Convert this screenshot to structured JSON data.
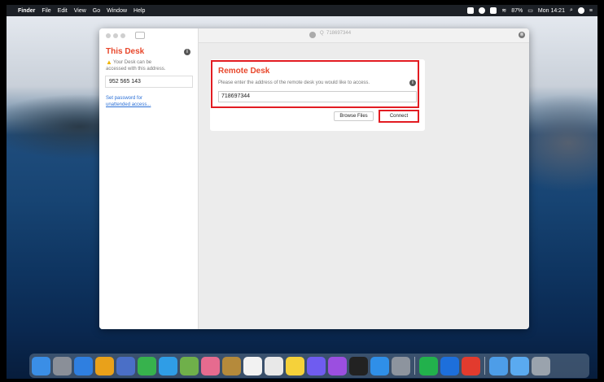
{
  "menubar": {
    "apple": "",
    "items": [
      "Finder",
      "File",
      "Edit",
      "View",
      "Go",
      "Window",
      "Help"
    ],
    "battery": "87%",
    "clock": "Mon 14:21"
  },
  "window": {
    "address_search_glyph": "Q",
    "address_text": "718697344",
    "address_clear": "⊗",
    "menu_glyph": "≡"
  },
  "this_desk": {
    "title": "This Desk",
    "info_glyph": "i",
    "warning_line1": "Your Desk can be",
    "warning_line2": "accessed with this address.",
    "address": "952 565 143",
    "password_link_line1": "Set password for",
    "password_link_line2": "unattended access..."
  },
  "remote_desk": {
    "title": "Remote Desk",
    "description": "Please enter the address of the remote desk you would like to access.",
    "info_glyph": "i",
    "input_value": "718697344",
    "browse_files_label": "Browse Files",
    "connect_label": "Connect"
  },
  "dock": {
    "icons": [
      {
        "name": "finder-icon",
        "color": "#3a8ee6"
      },
      {
        "name": "launchpad-icon",
        "color": "#8a8f98"
      },
      {
        "name": "safari-icon",
        "color": "#2f7fe0"
      },
      {
        "name": "chrome-icon",
        "color": "#e9a11a"
      },
      {
        "name": "mail-photo-icon",
        "color": "#4a6fc7"
      },
      {
        "name": "facetime-icon",
        "color": "#37b24d"
      },
      {
        "name": "messages-icon",
        "color": "#2f9de6"
      },
      {
        "name": "maps-icon",
        "color": "#6fb04a"
      },
      {
        "name": "photos-icon",
        "color": "#e66b8f"
      },
      {
        "name": "notes-brown-icon",
        "color": "#b58a3b"
      },
      {
        "name": "calendar-icon",
        "color": "#f2f2f2"
      },
      {
        "name": "reminders-icon",
        "color": "#e8e8e8"
      },
      {
        "name": "notes-icon",
        "color": "#f5d13a"
      },
      {
        "name": "music-icon",
        "color": "#6f5cf0"
      },
      {
        "name": "podcasts-icon",
        "color": "#9b4fe0"
      },
      {
        "name": "tv-icon",
        "color": "#222222"
      },
      {
        "name": "app-store-icon",
        "color": "#2f8fe8"
      },
      {
        "name": "system-preferences-icon",
        "color": "#8d949e"
      },
      {
        "name": "line-icon",
        "color": "#22b14c"
      },
      {
        "name": "teamviewer-icon",
        "color": "#1d6fdb"
      },
      {
        "name": "anydesk-icon",
        "color": "#e23b2e"
      },
      {
        "name": "downloads-folder-icon",
        "color": "#4d9de8"
      },
      {
        "name": "folder-icon",
        "color": "#5aaaf0"
      },
      {
        "name": "trash-icon",
        "color": "#9aa3ad"
      }
    ]
  }
}
